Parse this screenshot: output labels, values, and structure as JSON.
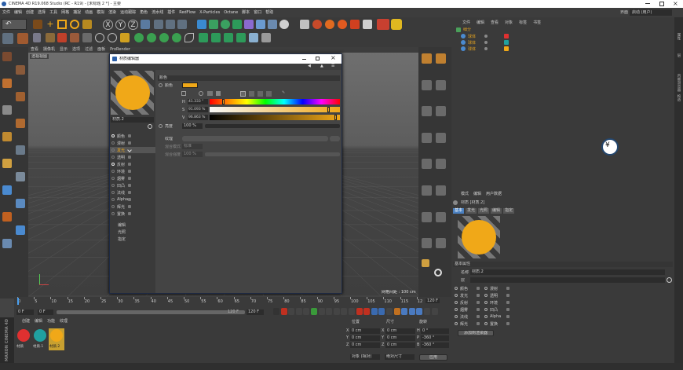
{
  "window": {
    "title": "CINEMA 4D R19.068 Studio (RC - R19) - [未标题 2 *] - 主要"
  },
  "menu": [
    "文件",
    "编辑",
    "创建",
    "选择",
    "工具",
    "网格",
    "捕捉",
    "动画",
    "模拟",
    "渲染",
    "运动跟踪",
    "角色",
    "流水线",
    "插件",
    "RedFlow",
    "X-Particles",
    "Octane",
    "脚本",
    "窗口",
    "帮助"
  ],
  "menu_right": {
    "layout_label": "界面",
    "layout_value": "启动 (用户)"
  },
  "viewport": {
    "tabs": [
      "查看",
      "摄像机",
      "显示",
      "选项",
      "过滤",
      "面板",
      "ProRender"
    ],
    "camera": "透视视图",
    "grid_spacing": "网格间距 : 100 cm"
  },
  "editor": {
    "title": "材质编辑器",
    "material_name": "材质.2",
    "section": "颜色",
    "color_label": "颜色",
    "color_hex": "#f0a818",
    "h_label": "H",
    "h_value": "41.333 °",
    "s_label": "S",
    "s_value": "91.093 %",
    "v_label": "V",
    "v_value": "96.863 %",
    "brightness_label": "亮度",
    "brightness_value": "100 %",
    "texture_label": "纹理",
    "mix_mode_label": "混合模式",
    "mix_mode_value": "标准",
    "mix_strength_label": "混合强度",
    "mix_strength_value": "100 %",
    "channels": [
      {
        "label": "颜色",
        "on": true
      },
      {
        "label": "漫射",
        "on": false
      },
      {
        "label": "发光",
        "on": false,
        "active": true
      },
      {
        "label": "透明",
        "on": false
      },
      {
        "label": "反射",
        "on": true
      },
      {
        "label": "环境",
        "on": false
      },
      {
        "label": "烟雾",
        "on": false
      },
      {
        "label": "凹凸",
        "on": false
      },
      {
        "label": "法线",
        "on": false
      },
      {
        "label": "Alpha",
        "on": false
      },
      {
        "label": "辉光",
        "on": false
      },
      {
        "label": "置换",
        "on": false
      }
    ],
    "extra": [
      "编辑",
      "光照",
      "指定"
    ]
  },
  "objmgr": {
    "tabs": [
      "文件",
      "编辑",
      "查看",
      "对象",
      "标签",
      "书签"
    ],
    "root": "细分",
    "rows": [
      {
        "label": "球体",
        "color": "#e03030"
      },
      {
        "label": "球体",
        "color": "#20a0a0"
      },
      {
        "label": "球体",
        "color": "#f0a818"
      }
    ]
  },
  "attrmgr": {
    "tabs": [
      "模式",
      "编辑",
      "用户数据"
    ],
    "object": "材质 [材质.2]",
    "subtabs": [
      "基本",
      "发光",
      "光照",
      "编辑",
      "指定"
    ],
    "section": "基本属性",
    "name_label": "名称",
    "name_value": "材质.2",
    "layer_label": "层",
    "channels_col1": [
      "颜色",
      "发光",
      "反射",
      "烟雾",
      "法线",
      "辉光"
    ],
    "channels_col2": [
      "漫射",
      "透明",
      "环境",
      "凹凸",
      "Alpha",
      "置换"
    ],
    "add_btn": "添加到渲染器"
  },
  "timeline": {
    "ticks": [
      "0",
      "5",
      "10",
      "15",
      "20",
      "25",
      "30",
      "35",
      "40",
      "45",
      "50",
      "55",
      "60",
      "65",
      "70",
      "75",
      "80",
      "85",
      "90",
      "95",
      "100",
      "105",
      "110",
      "115",
      "12"
    ],
    "frame_end": "120 F",
    "current": "0 F",
    "min": "0 F",
    "max": "120 F",
    "max2": "120 F"
  },
  "matmgr": {
    "tabs": [
      "创建",
      "编辑",
      "功能",
      "纹理"
    ],
    "materials": [
      {
        "name": "材质",
        "color": "#e03030"
      },
      {
        "name": "材质.1",
        "color": "#20a0a0"
      },
      {
        "name": "材质.2",
        "color": "#f0a818"
      }
    ]
  },
  "coord": {
    "headers": [
      "位置",
      "尺寸",
      "旋转"
    ],
    "rows": [
      {
        "axis": "X",
        "pos": "0 cm",
        "size": "0 cm",
        "rot_label": "H",
        "rot": "0 °"
      },
      {
        "axis": "Y",
        "pos": "0 cm",
        "size": "0 cm",
        "rot_label": "P",
        "rot": "-360 °"
      },
      {
        "axis": "Z",
        "pos": "0 cm",
        "size": "0 cm",
        "rot_label": "B",
        "rot": "-360 °"
      }
    ],
    "mode": "对象 (相对)",
    "size_mode": "绝对尺寸",
    "apply": "应用"
  },
  "strip": [
    "属性",
    "层",
    "内容浏览器",
    "构造"
  ],
  "logo": "MAXON CINEMA 4D"
}
